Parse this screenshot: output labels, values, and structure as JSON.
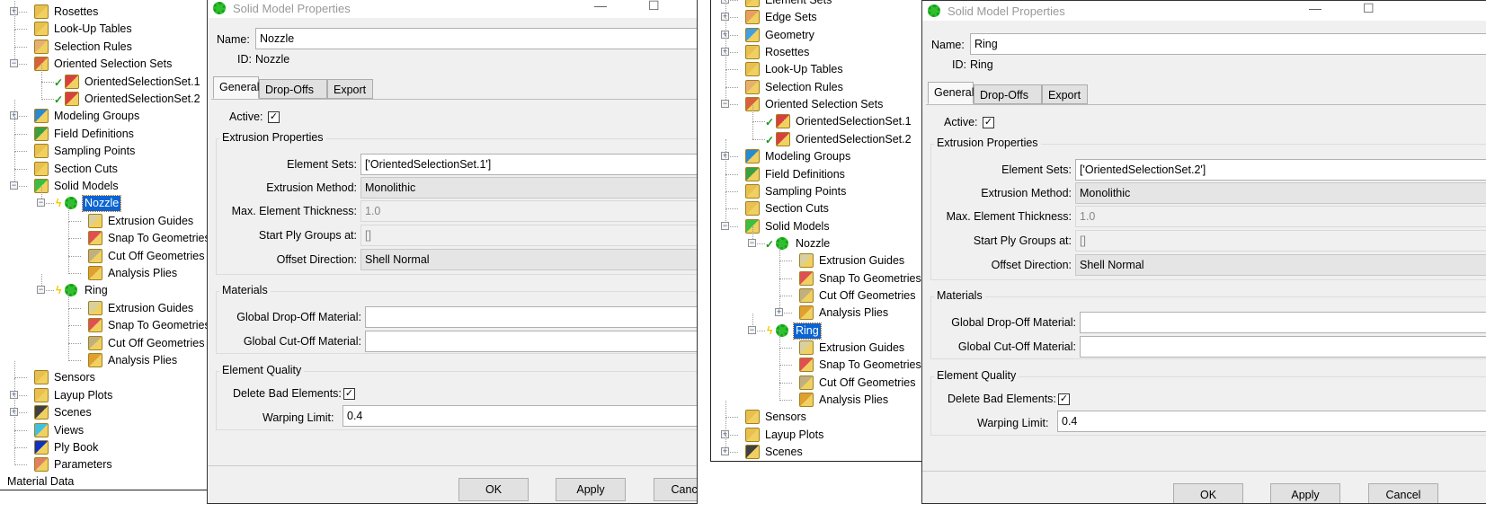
{
  "colors": {
    "selection": "#0a64d2",
    "check": "#1a9a1a",
    "gear": "#2ec02e"
  },
  "panels": [
    {
      "tree": {
        "rows": [
          {
            "label": "Rosettes",
            "level": 0,
            "exp": "+",
            "icon": "rosettes-icon",
            "color": "#e8c050"
          },
          {
            "label": "Look-Up Tables",
            "level": 0,
            "icon": "lookup-tables-icon",
            "color": "#e8c050"
          },
          {
            "label": "Selection Rules",
            "level": 0,
            "icon": "selection-rules-icon",
            "color": "#e8b070"
          },
          {
            "label": "Oriented Selection Sets",
            "level": 0,
            "exp": "-",
            "icon": "oriented-selection-sets-icon",
            "color": "#d86040"
          },
          {
            "label": "OrientedSelectionSet.1",
            "level": 1,
            "icon": "oriented-selection-set-icon",
            "color": "#d84040",
            "status": "check"
          },
          {
            "label": "OrientedSelectionSet.2",
            "level": 1,
            "icon": "oriented-selection-set-icon",
            "color": "#d84040",
            "status": "check"
          },
          {
            "label": "Modeling Groups",
            "level": 0,
            "exp": "+",
            "icon": "modeling-groups-icon",
            "color": "#2a8ad0"
          },
          {
            "label": "Field Definitions",
            "level": 0,
            "icon": "field-definitions-icon",
            "color": "#3aa040"
          },
          {
            "label": "Sampling Points",
            "level": 0,
            "icon": "sampling-points-icon",
            "color": "#e8c050"
          },
          {
            "label": "Section Cuts",
            "level": 0,
            "icon": "section-cuts-icon",
            "color": "#e8c050"
          },
          {
            "label": "Solid Models",
            "level": 0,
            "exp": "-",
            "icon": "solid-models-icon",
            "color": "#3ac040"
          },
          {
            "label": "Nozzle",
            "level": 1,
            "exp": "-",
            "icon": "gear-icon",
            "status": "bolt",
            "selected": true
          },
          {
            "label": "Extrusion Guides",
            "level": 2,
            "icon": "extrusion-guides-icon",
            "color": "#d8d0a0"
          },
          {
            "label": "Snap To Geometries",
            "level": 2,
            "icon": "snap-to-geometries-icon",
            "color": "#e05050"
          },
          {
            "label": "Cut Off Geometries",
            "level": 2,
            "icon": "cut-off-geometries-icon",
            "color": "#c0b080"
          },
          {
            "label": "Analysis Plies",
            "level": 2,
            "icon": "analysis-plies-icon",
            "color": "#e0a030"
          },
          {
            "label": "Ring",
            "level": 1,
            "exp": "-",
            "icon": "gear-icon",
            "status": "bolt"
          },
          {
            "label": "Extrusion Guides",
            "level": 2,
            "icon": "extrusion-guides-icon",
            "color": "#d8d0a0"
          },
          {
            "label": "Snap To Geometries",
            "level": 2,
            "icon": "snap-to-geometries-icon",
            "color": "#e05050"
          },
          {
            "label": "Cut Off Geometries",
            "level": 2,
            "icon": "cut-off-geometries-icon",
            "color": "#c0b080"
          },
          {
            "label": "Analysis Plies",
            "level": 2,
            "icon": "analysis-plies-icon",
            "color": "#e0a030"
          },
          {
            "label": "Sensors",
            "level": 0,
            "icon": "sensors-icon",
            "color": "#e8c050"
          },
          {
            "label": "Layup Plots",
            "level": 0,
            "exp": "+",
            "icon": "layup-plots-icon",
            "color": "#e8c050"
          },
          {
            "label": "Scenes",
            "level": 0,
            "exp": "+",
            "icon": "scenes-icon",
            "color": "#404040"
          },
          {
            "label": "Views",
            "level": 0,
            "icon": "views-icon",
            "color": "#40c0e0"
          },
          {
            "label": "Ply Book",
            "level": 0,
            "icon": "ply-book-icon",
            "color": "#1030c0"
          },
          {
            "label": "Parameters",
            "level": 0,
            "icon": "parameters-icon",
            "color": "#e08060"
          },
          {
            "label": "Material Data",
            "level": -1
          }
        ]
      },
      "dialog": {
        "title": "Solid Model Properties",
        "name_label": "Name:",
        "name_value": "Nozzle",
        "id_label": "ID:",
        "id_value": "Nozzle",
        "tabs": [
          "General",
          "Drop-Offs",
          "Export"
        ],
        "active_label": "Active:",
        "active_checked": true,
        "extrusion_group": "Extrusion Properties",
        "element_sets_label": "Element Sets:",
        "element_sets_value": "['OrientedSelectionSet.1']",
        "extrusion_method_label": "Extrusion Method:",
        "extrusion_method_value": "Monolithic",
        "max_thickness_label": "Max. Element Thickness:",
        "max_thickness_value": "1.0",
        "start_ply_label": "Start Ply Groups at:",
        "start_ply_value": "[]",
        "offset_label": "Offset Direction:",
        "offset_value": "Shell Normal",
        "materials_group": "Materials",
        "dropoff_label": "Global Drop-Off Material:",
        "dropoff_value": "",
        "cutoff_label": "Global Cut-Off Material:",
        "cutoff_value": "",
        "quality_group": "Element Quality",
        "delete_bad_label": "Delete Bad Elements:",
        "delete_bad_checked": true,
        "warping_label": "Warping Limit:",
        "warping_value": "0.4",
        "buttons": [
          "OK",
          "Apply",
          "Cancel"
        ]
      }
    },
    {
      "tree": {
        "rows": [
          {
            "label": "Element Sets",
            "level": 0,
            "exp": "+",
            "icon": "element-sets-icon",
            "color": "#e8c050"
          },
          {
            "label": "Edge Sets",
            "level": 0,
            "exp": "+",
            "icon": "edge-sets-icon",
            "color": "#e8a060"
          },
          {
            "label": "Geometry",
            "level": 0,
            "exp": "+",
            "icon": "geometry-icon",
            "color": "#40a0e0"
          },
          {
            "label": "Rosettes",
            "level": 0,
            "exp": "+",
            "icon": "rosettes-icon",
            "color": "#e8c050"
          },
          {
            "label": "Look-Up Tables",
            "level": 0,
            "icon": "lookup-tables-icon",
            "color": "#e8c050"
          },
          {
            "label": "Selection Rules",
            "level": 0,
            "icon": "selection-rules-icon",
            "color": "#e8b070"
          },
          {
            "label": "Oriented Selection Sets",
            "level": 0,
            "exp": "-",
            "icon": "oriented-selection-sets-icon",
            "color": "#d86040"
          },
          {
            "label": "OrientedSelectionSet.1",
            "level": 1,
            "icon": "oriented-selection-set-icon",
            "color": "#d84040",
            "status": "check"
          },
          {
            "label": "OrientedSelectionSet.2",
            "level": 1,
            "icon": "oriented-selection-set-icon",
            "color": "#d84040",
            "status": "check"
          },
          {
            "label": "Modeling Groups",
            "level": 0,
            "exp": "+",
            "icon": "modeling-groups-icon",
            "color": "#2a8ad0"
          },
          {
            "label": "Field Definitions",
            "level": 0,
            "icon": "field-definitions-icon",
            "color": "#3aa040"
          },
          {
            "label": "Sampling Points",
            "level": 0,
            "icon": "sampling-points-icon",
            "color": "#e8c050"
          },
          {
            "label": "Section Cuts",
            "level": 0,
            "icon": "section-cuts-icon",
            "color": "#e8c050"
          },
          {
            "label": "Solid Models",
            "level": 0,
            "exp": "-",
            "icon": "solid-models-icon",
            "color": "#3ac040"
          },
          {
            "label": "Nozzle",
            "level": 1,
            "exp": "-",
            "icon": "gear-icon",
            "status": "check"
          },
          {
            "label": "Extrusion Guides",
            "level": 2,
            "icon": "extrusion-guides-icon",
            "color": "#d8d0a0"
          },
          {
            "label": "Snap To Geometries",
            "level": 2,
            "icon": "snap-to-geometries-icon",
            "color": "#e05050"
          },
          {
            "label": "Cut Off Geometries",
            "level": 2,
            "icon": "cut-off-geometries-icon",
            "color": "#c0b080"
          },
          {
            "label": "Analysis Plies",
            "level": 2,
            "exp": "+",
            "icon": "analysis-plies-icon",
            "color": "#e0a030"
          },
          {
            "label": "Ring",
            "level": 1,
            "exp": "-",
            "icon": "gear-icon",
            "status": "bolt",
            "selected": true
          },
          {
            "label": "Extrusion Guides",
            "level": 2,
            "icon": "extrusion-guides-icon",
            "color": "#d8d0a0"
          },
          {
            "label": "Snap To Geometries",
            "level": 2,
            "icon": "snap-to-geometries-icon",
            "color": "#e05050"
          },
          {
            "label": "Cut Off Geometries",
            "level": 2,
            "icon": "cut-off-geometries-icon",
            "color": "#c0b080"
          },
          {
            "label": "Analysis Plies",
            "level": 2,
            "icon": "analysis-plies-icon",
            "color": "#e0a030"
          },
          {
            "label": "Sensors",
            "level": 0,
            "icon": "sensors-icon",
            "color": "#e8c050"
          },
          {
            "label": "Layup Plots",
            "level": 0,
            "exp": "+",
            "icon": "layup-plots-icon",
            "color": "#e8c050"
          },
          {
            "label": "Scenes",
            "level": 0,
            "exp": "+",
            "icon": "scenes-icon",
            "color": "#404040"
          }
        ]
      },
      "dialog": {
        "title": "Solid Model Properties",
        "name_label": "Name:",
        "name_value": "Ring",
        "id_label": "ID:",
        "id_value": "Ring",
        "tabs": [
          "General",
          "Drop-Offs",
          "Export"
        ],
        "active_label": "Active:",
        "active_checked": true,
        "extrusion_group": "Extrusion Properties",
        "element_sets_label": "Element Sets:",
        "element_sets_value": "['OrientedSelectionSet.2']",
        "extrusion_method_label": "Extrusion Method:",
        "extrusion_method_value": "Monolithic",
        "max_thickness_label": "Max. Element Thickness:",
        "max_thickness_value": "1.0",
        "start_ply_label": "Start Ply Groups at:",
        "start_ply_value": "[]",
        "offset_label": "Offset Direction:",
        "offset_value": "Shell Normal",
        "materials_group": "Materials",
        "dropoff_label": "Global Drop-Off Material:",
        "dropoff_value": "",
        "cutoff_label": "Global Cut-Off Material:",
        "cutoff_value": "",
        "quality_group": "Element Quality",
        "delete_bad_label": "Delete Bad Elements:",
        "delete_bad_checked": true,
        "warping_label": "Warping Limit:",
        "warping_value": "0.4",
        "buttons": [
          "OK",
          "Apply",
          "Cancel"
        ]
      }
    }
  ]
}
